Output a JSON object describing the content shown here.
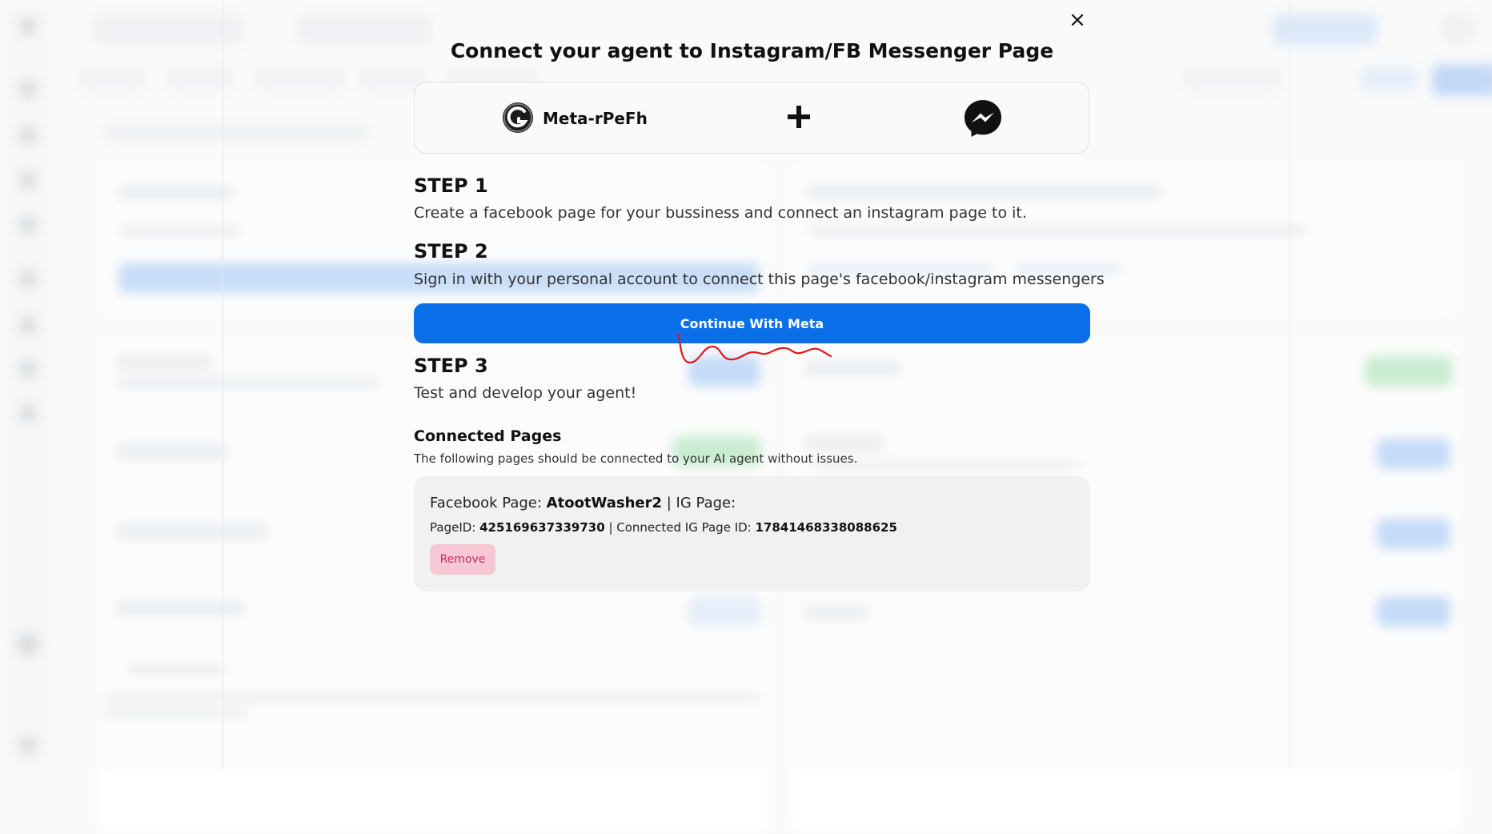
{
  "modal": {
    "close_symbol": "×",
    "title": "Connect your agent to Instagram/FB Messenger Page",
    "agent_name": "Meta-rPeFh",
    "plus_symbol": "+",
    "steps": [
      {
        "heading": "STEP 1",
        "text": "Create a facebook page for your bussiness and connect an instagram page to it."
      },
      {
        "heading": "STEP 2",
        "text": "Sign in with your personal account to connect this page's facebook/instagram messengers"
      },
      {
        "heading": "STEP 3",
        "text": "Test and develop your agent!"
      }
    ],
    "continue_button": "Continue With Meta",
    "connected_pages": {
      "title": "Connected Pages",
      "description": "The following pages should be connected to your AI agent without issues.",
      "pages": [
        {
          "fb_label": "Facebook Page: ",
          "fb_name": "AtootWasher2",
          "ig_label": " | IG Page:",
          "page_id_label": "PageID: ",
          "page_id": "425169637339730",
          "ig_id_label": " | Connected IG Page ID: ",
          "ig_id": "17841468338088625",
          "remove_label": "Remove"
        }
      ]
    }
  },
  "colors": {
    "primary": "#0a6fe8",
    "remove_bg": "#f6c8d6",
    "remove_text": "#d6246b",
    "annotation": "#e0161b"
  }
}
